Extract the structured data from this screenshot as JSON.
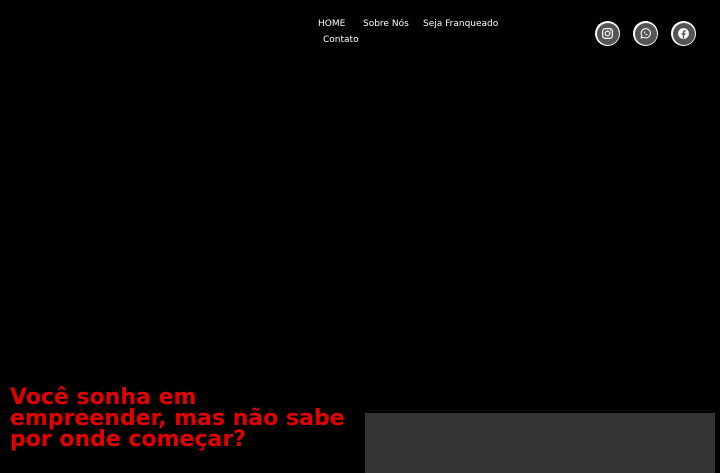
{
  "nav": {
    "items": [
      {
        "label": "HOME"
      },
      {
        "label": "Sobre Nós"
      },
      {
        "label": "Seja Franqueado"
      },
      {
        "label": "Contato"
      }
    ]
  },
  "social": [
    {
      "icon": "instagram-icon"
    },
    {
      "icon": "whatsapp-icon"
    },
    {
      "icon": "facebook-icon"
    }
  ],
  "hero": {
    "headline": "Você sonha em empreender, mas não sabe por onde começar?"
  },
  "colors": {
    "background": "#000000",
    "headline": "#e30000",
    "social_circle": "#555555",
    "panel": "#333333"
  }
}
